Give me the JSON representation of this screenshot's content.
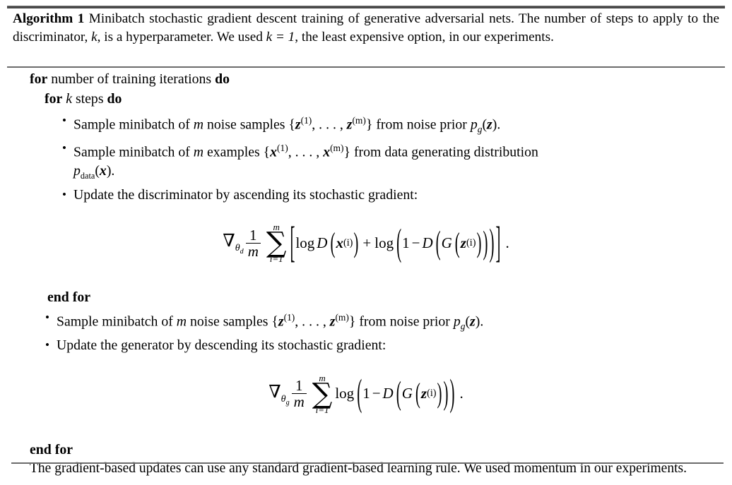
{
  "document": {
    "type": "algorithm-float",
    "label": "Algorithm 1",
    "caption": "Minibatch stochastic gradient descent training of generative adversarial nets. The number of steps to apply to the discriminator, k, is a hyperparameter. We used k = 1, the least expensive option, in our experiments.",
    "caption_parts": {
      "before_k1": "Minibatch stochastic gradient descent training of generative adversarial nets. The number of steps to apply to the discriminator, ",
      "k_symbol": "k",
      "after_k1": ", is a hyperparameter. We used ",
      "k_eq": "k = 1",
      "after_k2": ", the least expensive option, in our experiments."
    },
    "colors": {
      "background": "#ffffff",
      "text": "#000000",
      "rule": "#6b6b6b",
      "rule_top": "#4a4a4a"
    }
  },
  "algorithm": {
    "lines": {
      "for_outer_kw1": "for",
      "for_outer_text": "number of training iterations",
      "for_outer_kw2": "do",
      "for_inner_kw1": "for",
      "for_inner_var": "k",
      "for_inner_text": "steps",
      "for_inner_kw2": "do",
      "end_for_inner": "end for",
      "end_for_outer": "end for"
    },
    "bullets": [
      {
        "id": "sample-noise-d",
        "bullet": "•",
        "text": "Sample minibatch of m noise samples {z^(1), ..., z^(m)} from noise prior p_g(z).",
        "segments": {
          "s1": "Sample minibatch of ",
          "m": "m",
          "s2": " noise samples ",
          "brace_open": "{",
          "z1": "z",
          "z1_sup": "(1)",
          "comma_dots": ", . . . , ",
          "z2": "z",
          "z2_sup": "(m)",
          "brace_close": "}",
          "s3": " from noise prior ",
          "p": "p",
          "p_sub": "g",
          "paren_open": "(",
          "zarg": "z",
          "paren_close": ")",
          "period": "."
        }
      },
      {
        "id": "sample-data-x",
        "bullet": "•",
        "text": "Sample minibatch of m examples {x^(1), ..., x^(m)} from data generating distribution p_data(x).",
        "segments": {
          "s1": "Sample minibatch of ",
          "m": "m",
          "s2": " examples ",
          "brace_open": "{",
          "x1": "x",
          "x1_sup": "(1)",
          "comma_dots": ", . . . , ",
          "x2": "x",
          "x2_sup": "(m)",
          "brace_close": "}",
          "s3": " from data generating distribution",
          "p": "p",
          "p_sub": "data",
          "paren_open": "(",
          "xarg": "x",
          "paren_close": ")",
          "period": "."
        }
      },
      {
        "id": "update-discriminator",
        "bullet": "•",
        "text": "Update the discriminator by ascending its stochastic gradient:"
      },
      {
        "id": "sample-noise-g",
        "bullet": "•",
        "text": "Sample minibatch of m noise samples {z^(1), ..., z^(m)} from noise prior p_g(z)."
      },
      {
        "id": "update-generator",
        "bullet": "•",
        "text": "Update the generator by descending its stochastic gradient:"
      }
    ],
    "equations": [
      {
        "id": "discriminator-gradient",
        "latex": "\\nabla_{\\theta_d} \\frac{1}{m} \\sum_{i=1}^{m} \\left[ \\log D\\left(\\boldsymbol{x}^{(i)}\\right) + \\log\\left(1 - D\\left(G\\left(\\boldsymbol{z}^{(i)}\\right)\\right)\\right) \\right].",
        "tokens": {
          "nabla": "∇",
          "nabla_sub_theta": "θ",
          "nabla_sub_idx": "d",
          "frac_num": "1",
          "frac_den": "m",
          "sum_glyph": "∑",
          "sum_upper": "m",
          "sum_lower": "i=1",
          "bracket_open": "[",
          "log1": "log",
          "D1": "D",
          "x": "x",
          "x_sup": "(i)",
          "plus": "+",
          "log2": "log",
          "one": "1",
          "minus": "−",
          "D2": "D",
          "G": "G",
          "z": "z",
          "z_sup": "(i)",
          "bracket_close": "]",
          "period": "."
        }
      },
      {
        "id": "generator-gradient",
        "latex": "\\nabla_{\\theta_g} \\frac{1}{m} \\sum_{i=1}^{m} \\log\\left(1 - D\\left(G\\left(\\boldsymbol{z}^{(i)}\\right)\\right)\\right).",
        "tokens": {
          "nabla": "∇",
          "nabla_sub_theta": "θ",
          "nabla_sub_idx": "g",
          "frac_num": "1",
          "frac_den": "m",
          "sum_glyph": "∑",
          "sum_upper": "m",
          "sum_lower": "i=1",
          "log": "log",
          "one": "1",
          "minus": "−",
          "D": "D",
          "G": "G",
          "z": "z",
          "z_sup": "(i)",
          "period": "."
        }
      }
    ],
    "closing_paragraph": "The gradient-based updates can use any standard gradient-based learning rule. We used momentum in our experiments."
  }
}
